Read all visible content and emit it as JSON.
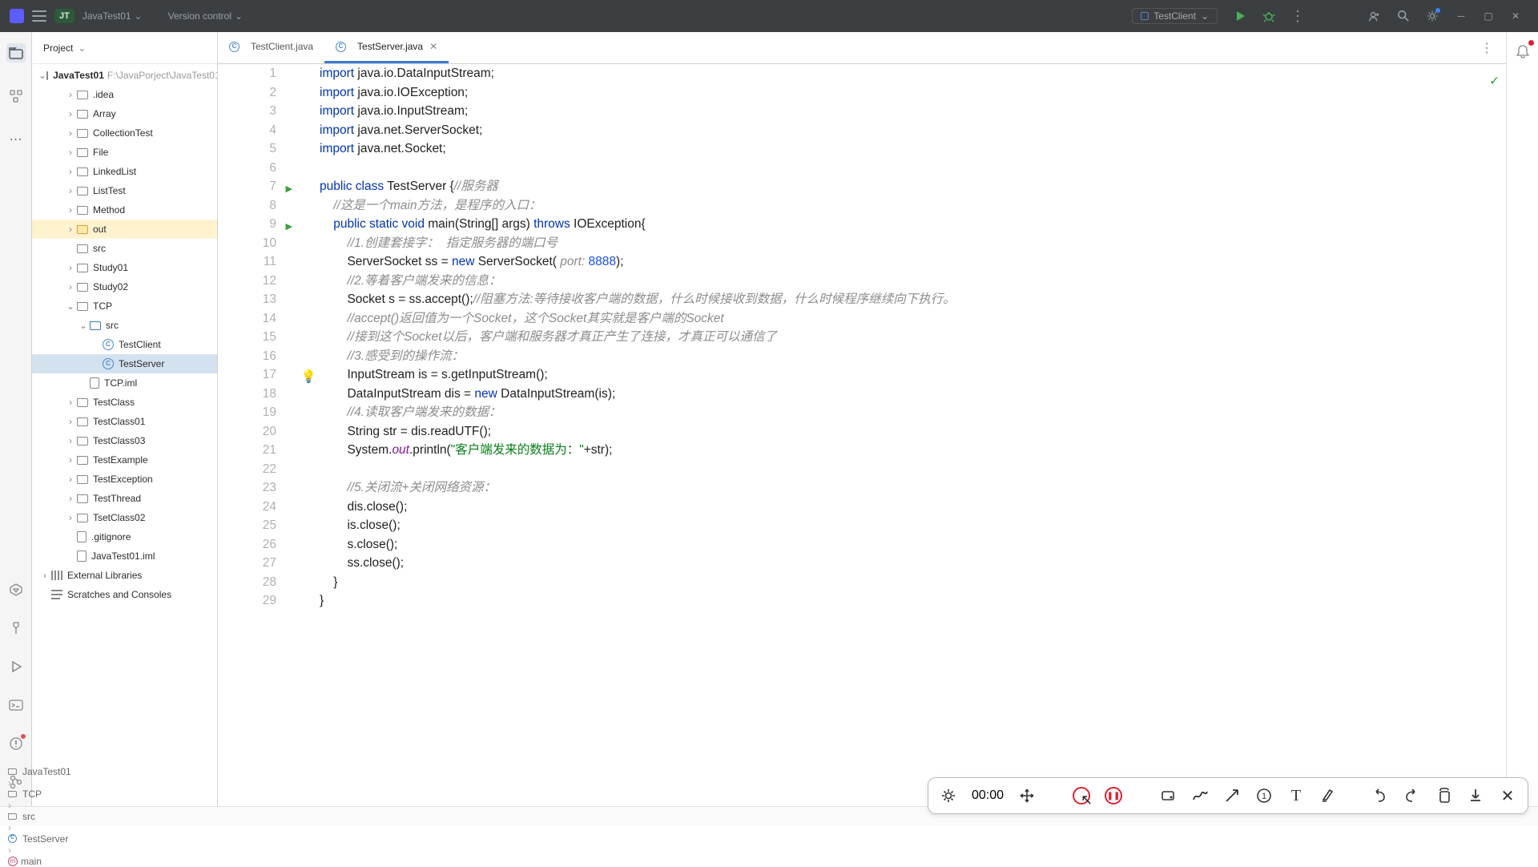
{
  "title_bar": {
    "project_chip": "JT",
    "project_name": "JavaTest01",
    "vcs_label": "Version control",
    "run_config_label": "TestClient"
  },
  "proj_panel": {
    "header": "Project",
    "root": {
      "name": "JavaTest01",
      "path": "F:\\JavaPorject\\JavaTest01"
    },
    "external_libs": "External Libraries",
    "scratches": "Scratches and Consoles"
  },
  "tree_items": [
    {
      "name": ".idea",
      "depth": 2,
      "arrow": true,
      "ico": "folder"
    },
    {
      "name": "Array",
      "depth": 2,
      "arrow": true,
      "ico": "folder"
    },
    {
      "name": "CollectionTest",
      "depth": 2,
      "arrow": true,
      "ico": "folder"
    },
    {
      "name": "File",
      "depth": 2,
      "arrow": true,
      "ico": "folder"
    },
    {
      "name": "LinkedList",
      "depth": 2,
      "arrow": true,
      "ico": "folder"
    },
    {
      "name": "ListTest",
      "depth": 2,
      "arrow": true,
      "ico": "folder"
    },
    {
      "name": "Method",
      "depth": 2,
      "arrow": true,
      "ico": "folder"
    },
    {
      "name": "out",
      "depth": 2,
      "arrow": true,
      "ico": "folder-out",
      "hl": "out"
    },
    {
      "name": "src",
      "depth": 2,
      "arrow": false,
      "ico": "folder"
    },
    {
      "name": "Study01",
      "depth": 2,
      "arrow": true,
      "ico": "folder"
    },
    {
      "name": "Study02",
      "depth": 2,
      "arrow": true,
      "ico": "folder"
    },
    {
      "name": "TCP",
      "depth": 2,
      "arrow": true,
      "ico": "folder",
      "open": true
    },
    {
      "name": "src",
      "depth": 3,
      "arrow": true,
      "ico": "folder-src",
      "open": true
    },
    {
      "name": "TestClient",
      "depth": 4,
      "arrow": false,
      "ico": "java"
    },
    {
      "name": "TestServer",
      "depth": 4,
      "arrow": false,
      "ico": "java",
      "hl": "srv"
    },
    {
      "name": "TCP.iml",
      "depth": 3,
      "arrow": false,
      "ico": "file"
    },
    {
      "name": "TestClass",
      "depth": 2,
      "arrow": true,
      "ico": "folder"
    },
    {
      "name": "TestClass01",
      "depth": 2,
      "arrow": true,
      "ico": "folder"
    },
    {
      "name": "TestClass03",
      "depth": 2,
      "arrow": true,
      "ico": "folder"
    },
    {
      "name": "TestExample",
      "depth": 2,
      "arrow": true,
      "ico": "folder"
    },
    {
      "name": "TestException",
      "depth": 2,
      "arrow": true,
      "ico": "folder"
    },
    {
      "name": "TestThread",
      "depth": 2,
      "arrow": true,
      "ico": "folder"
    },
    {
      "name": "TsetClass02",
      "depth": 2,
      "arrow": true,
      "ico": "folder"
    },
    {
      "name": ".gitignore",
      "depth": 2,
      "arrow": false,
      "ico": "file"
    },
    {
      "name": "JavaTest01.iml",
      "depth": 2,
      "arrow": false,
      "ico": "file"
    }
  ],
  "tabs": [
    {
      "label": "TestClient.java",
      "active": false
    },
    {
      "label": "TestServer.java",
      "active": true
    }
  ],
  "code_lines": [
    {
      "n": 1,
      "html": "<span class='kw'>import</span> java.io.DataInputStream;"
    },
    {
      "n": 2,
      "html": "<span class='kw'>import</span> java.io.IOException;"
    },
    {
      "n": 3,
      "html": "<span class='kw'>import</span> java.io.InputStream;"
    },
    {
      "n": 4,
      "html": "<span class='kw'>import</span> java.net.ServerSocket;"
    },
    {
      "n": 5,
      "html": "<span class='kw'>import</span> java.net.Socket;"
    },
    {
      "n": 6,
      "html": ""
    },
    {
      "n": 7,
      "run": true,
      "html": "<span class='kw'>public class</span> TestServer {<span class='comment'>//服务器</span>"
    },
    {
      "n": 8,
      "html": "    <span class='comment'>//这是一个main方法，是程序的入口：</span>"
    },
    {
      "n": 9,
      "run": true,
      "html": "    <span class='kw'>public static void</span> main(String[] args) <span class='kw'>throws</span> IOException{"
    },
    {
      "n": 10,
      "html": "        <span class='comment'>//1.创建套接字：  指定服务器的端口号</span>"
    },
    {
      "n": 11,
      "html": "        ServerSocket ss = <span class='kw'>new</span> ServerSocket( <span class='paramhint'>port:</span> <span class='num'>8888</span>);"
    },
    {
      "n": 12,
      "html": "        <span class='comment'>//2.等着客户端发来的信息：</span>"
    },
    {
      "n": 13,
      "html": "        Socket s = ss.accept();<span class='comment'>//阻塞方法:等待接收客户端的数据，什么时候接收到数据，什么时候程序继续向下执行。</span>"
    },
    {
      "n": 14,
      "html": "        <span class='comment'>//accept()返回值为一个Socket，这个Socket其实就是客户端的Socket</span>"
    },
    {
      "n": 15,
      "html": "        <span class='comment'>//接到这个Socket以后，客户端和服务器才真正产生了连接，才真正可以通信了</span>"
    },
    {
      "n": 16,
      "html": "        <span class='comment'>//3.感受到的操作流：</span>"
    },
    {
      "n": 17,
      "bulb": true,
      "html": "        InputStream is = s.getInputStream();"
    },
    {
      "n": 18,
      "html": "        DataInputStream dis = <span class='kw'>new</span> DataInputStream(is);"
    },
    {
      "n": 19,
      "html": "        <span class='comment'>//4.读取客户端发来的数据：</span>"
    },
    {
      "n": 20,
      "html": "        String str = dis.readUTF();"
    },
    {
      "n": 21,
      "html": "        System.<span class='field'>out</span>.println(<span class='str'>\"客户端发来的数据为：\"</span>+str);"
    },
    {
      "n": 22,
      "html": ""
    },
    {
      "n": 23,
      "html": "        <span class='comment'>//5.关闭流+关闭网络资源：</span>"
    },
    {
      "n": 24,
      "html": "        dis.close();"
    },
    {
      "n": 25,
      "html": "        is.close();"
    },
    {
      "n": 26,
      "html": "        s.close();"
    },
    {
      "n": 27,
      "html": "        ss.close();"
    },
    {
      "n": 28,
      "html": "    }"
    },
    {
      "n": 29,
      "html": "}"
    }
  ],
  "breadcrumbs": [
    {
      "ico": "folder",
      "label": "JavaTest01"
    },
    {
      "ico": "folder",
      "label": "TCP"
    },
    {
      "ico": "folder",
      "label": "src"
    },
    {
      "ico": "java",
      "label": "TestServer"
    },
    {
      "ico": "method",
      "label": "main"
    }
  ],
  "recorder": {
    "time": "00:00"
  }
}
